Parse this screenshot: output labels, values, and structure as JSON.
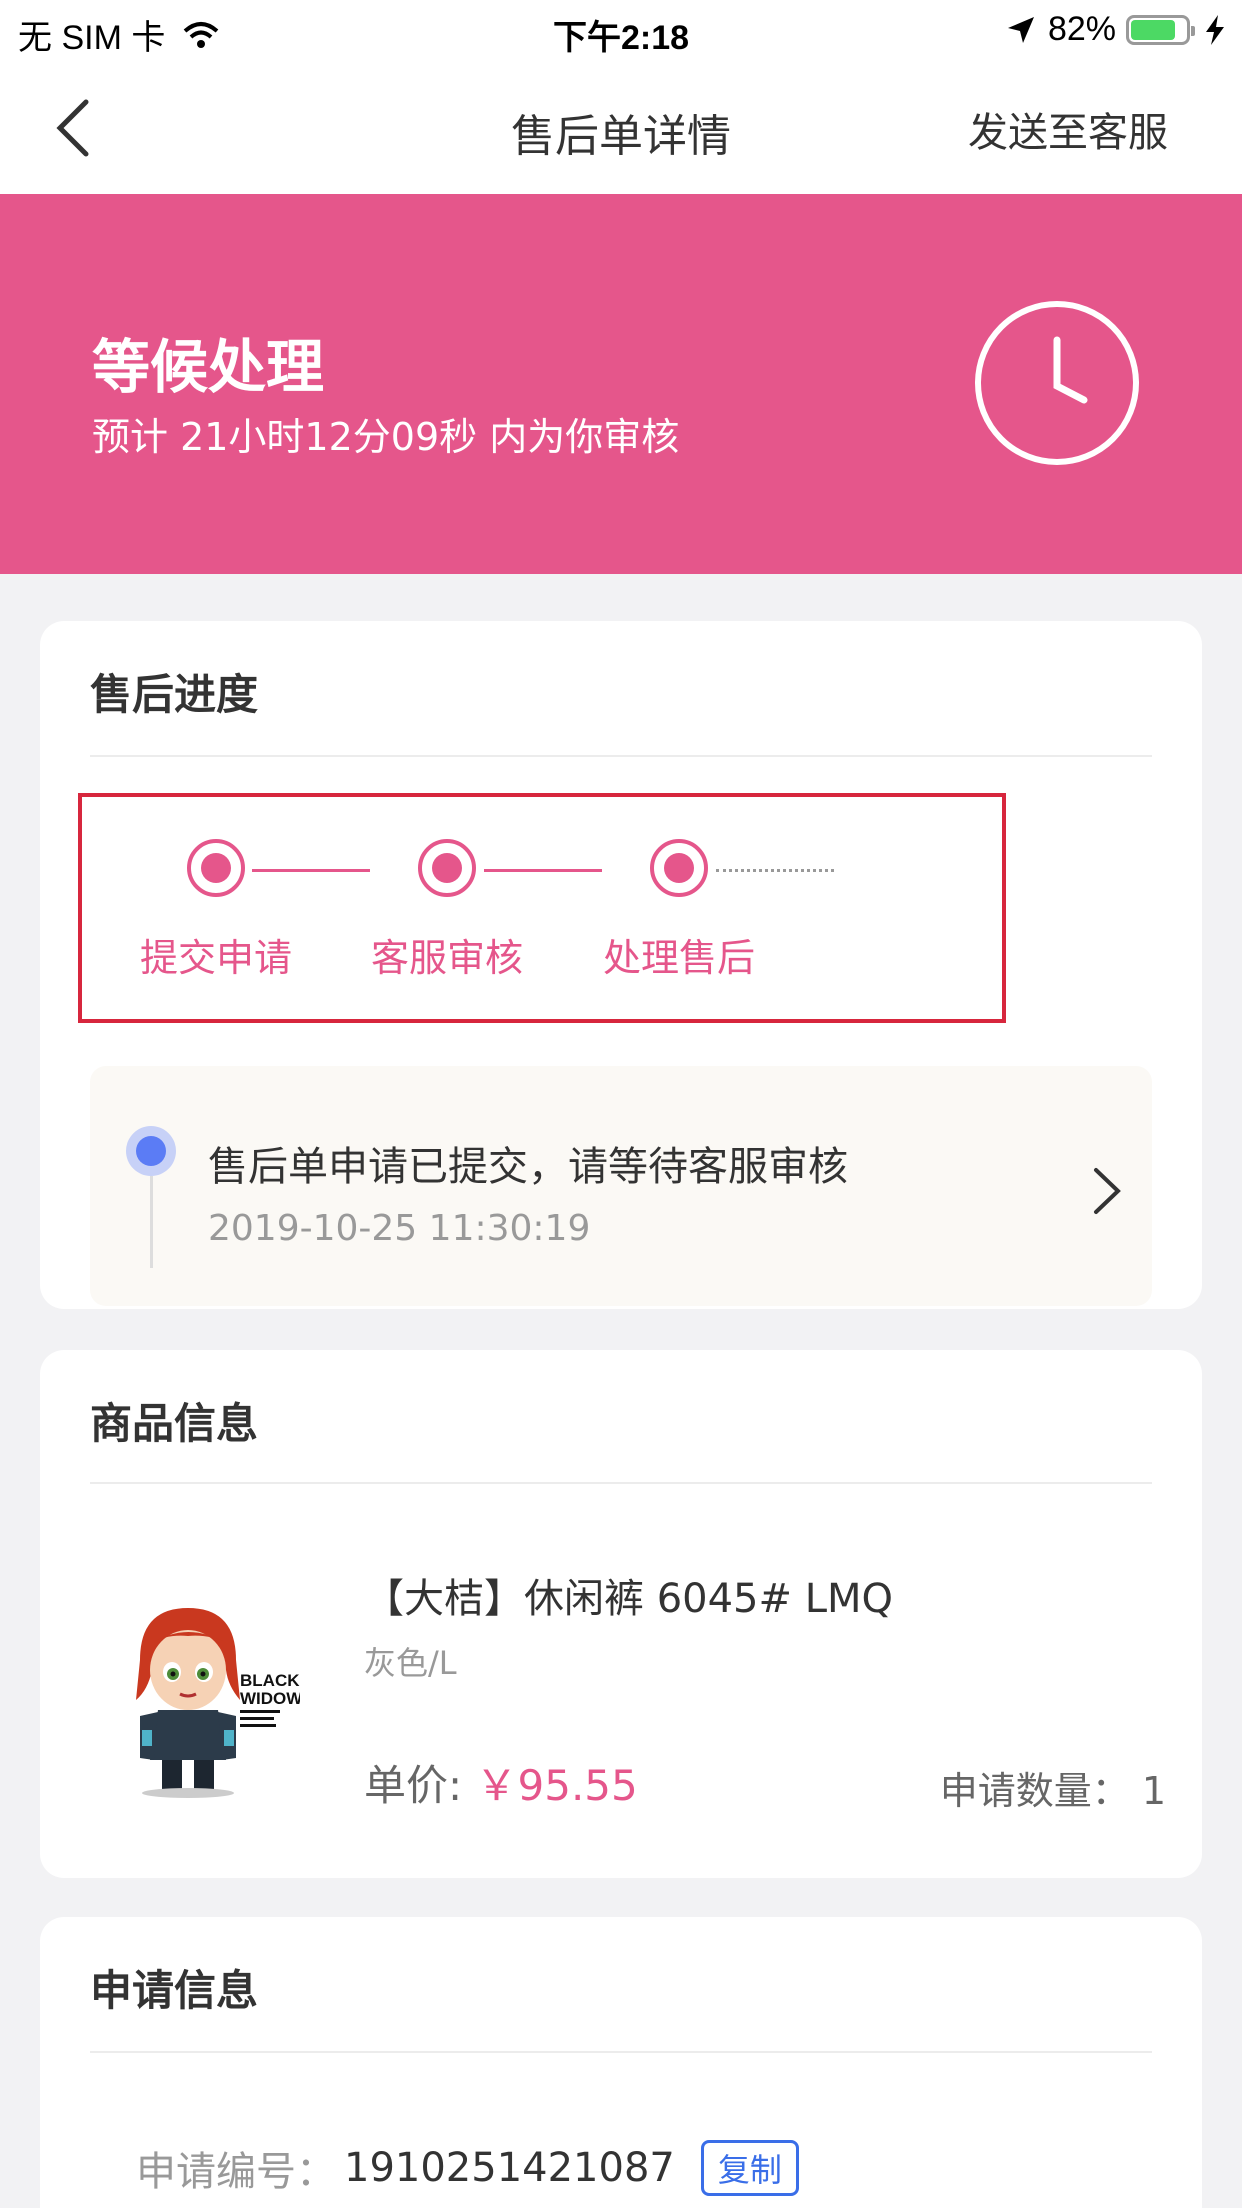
{
  "status_bar": {
    "carrier": "无 SIM 卡",
    "time": "下午2:18",
    "battery_percent": "82%",
    "battery_level": 0.82
  },
  "nav": {
    "title": "售后单详情",
    "action": "发送至客服"
  },
  "banner": {
    "title": "等候处理",
    "subtitle": "预计 21小时12分09秒 内为你审核",
    "color": "#e5568b"
  },
  "progress": {
    "title": "售后进度",
    "steps": [
      {
        "label": "提交申请"
      },
      {
        "label": "客服审核"
      },
      {
        "label": "处理售后"
      }
    ],
    "log": {
      "text": "售后单申请已提交，请等待客服审核",
      "time": "2019-10-25 11:30:19"
    }
  },
  "product": {
    "title": "商品信息",
    "name": "【大桔】休闲裤 6045# LMQ",
    "spec": "灰色/L",
    "price_label": "单价:",
    "price": "￥95.55",
    "qty_label": "申请数量：",
    "qty": "1",
    "image_caption": "BLACK WIDOW"
  },
  "apply": {
    "title": "申请信息",
    "number_label": "申请编号：",
    "number": "1910251421087",
    "copy_label": "复制"
  }
}
